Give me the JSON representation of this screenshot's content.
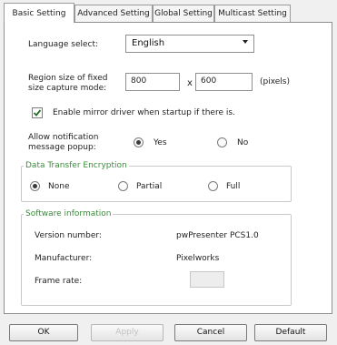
{
  "tabs": [
    {
      "label": "Basic Setting",
      "active": true
    },
    {
      "label": "Advanced Setting",
      "active": false
    },
    {
      "label": "Global Setting",
      "active": false
    },
    {
      "label": "Multicast Setting",
      "active": false
    }
  ],
  "language": {
    "label": "Language select:",
    "selected": "English"
  },
  "region": {
    "label_line1": "Region size of fixed",
    "label_line2": "size capture mode:",
    "width": "800",
    "separator": "x",
    "height": "600",
    "unit": "(pixels)"
  },
  "mirror": {
    "label": "Enable mirror driver when startup if there is.",
    "checked": true
  },
  "notification": {
    "label_line1": "Allow notification",
    "label_line2": "message popup:",
    "yes": "Yes",
    "no": "No",
    "selected": "Yes"
  },
  "encryption": {
    "legend": "Data Transfer Encryption",
    "none": "None",
    "partial": "Partial",
    "full": "Full",
    "selected": "None",
    "legend_color": "#3c8a3c"
  },
  "software": {
    "legend": "Software information",
    "version_label": "Version number:",
    "version_value": "pwPresenter PCS1.0",
    "manufacturer_label": "Manufacturer:",
    "manufacturer_value": "Pixelworks",
    "frame_rate_label": "Frame rate:",
    "frame_rate_value": "",
    "legend_color": "#3c8a3c"
  },
  "buttons": {
    "ok": "OK",
    "apply": "Apply",
    "cancel": "Cancel",
    "default": "Default"
  },
  "icons": {
    "check": "checkmark-icon",
    "dropdown": "chevron-down-icon"
  }
}
